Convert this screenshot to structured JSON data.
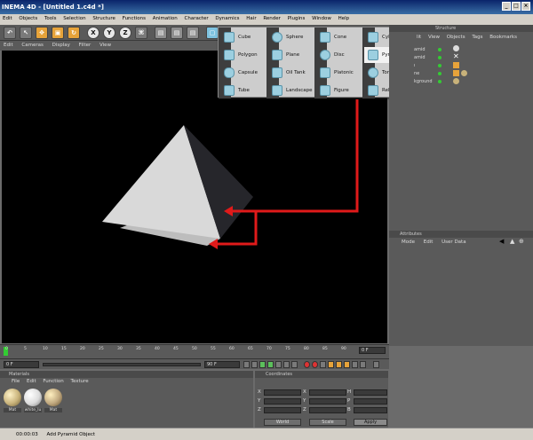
{
  "app": {
    "title": "INEMA 4D - [Untitled 1.c4d *]",
    "window_controls": [
      "_",
      "□",
      "×"
    ]
  },
  "menubar": [
    "Edit",
    "Objects",
    "Tools",
    "Selection",
    "Structure",
    "Functions",
    "Animation",
    "Character",
    "Dynamics",
    "Hair",
    "Render",
    "Plugins",
    "Window",
    "Help"
  ],
  "toolbar": {
    "axis_buttons": [
      "X",
      "Y",
      "Z"
    ]
  },
  "viewport": {
    "menu": [
      "Edit",
      "Cameras",
      "Display",
      "Filter",
      "View"
    ]
  },
  "dropdown": {
    "items": [
      {
        "label": "Cube",
        "icon": "cube-icon"
      },
      {
        "label": "Sphere",
        "icon": "sphere-icon"
      },
      {
        "label": "Cone",
        "icon": "cone-icon"
      },
      {
        "label": "Cylinder",
        "icon": "cylinder-icon"
      },
      {
        "label": "Polygon",
        "icon": "polygon-icon"
      },
      {
        "label": "Plane",
        "icon": "plane-icon"
      },
      {
        "label": "Disc",
        "icon": "disc-icon"
      },
      {
        "label": "Pyramid",
        "icon": "pyramid-icon",
        "selected": true
      },
      {
        "label": "Capsule",
        "icon": "capsule-icon"
      },
      {
        "label": "Oil Tank",
        "icon": "oil-tank-icon"
      },
      {
        "label": "Platonic",
        "icon": "platonic-icon"
      },
      {
        "label": "Torus",
        "icon": "torus-icon"
      },
      {
        "label": "Tube",
        "icon": "tube-icon"
      },
      {
        "label": "Landscape",
        "icon": "landscape-icon"
      },
      {
        "label": "Figure",
        "icon": "figure-icon"
      },
      {
        "label": "Relief",
        "icon": "relief-icon"
      }
    ]
  },
  "objects_panel": {
    "header": "Structure",
    "menu": [
      "lit",
      "View",
      "Objects",
      "Tags",
      "Bookmarks"
    ],
    "rows": [
      "amid",
      "amid",
      "ı",
      "ne",
      "kground"
    ]
  },
  "attributes_panel": {
    "header": "Attributes",
    "menu": [
      "Mode",
      "Edit",
      "User Data"
    ]
  },
  "timeline": {
    "ticks": [
      "0",
      "5",
      "10",
      "15",
      "20",
      "25",
      "30",
      "35",
      "40",
      "45",
      "50",
      "55",
      "60",
      "65",
      "70",
      "75",
      "80",
      "85",
      "90"
    ],
    "end_field": "0 F",
    "start_field": "0 F",
    "end_frame": "90 F"
  },
  "materials_panel": {
    "header": "Materials",
    "menu": [
      "File",
      "Edit",
      "Function",
      "Texture"
    ],
    "materials": [
      {
        "label": "Mat",
        "color": "#c8b27a"
      },
      {
        "label": "white_lu",
        "color": "#e8e8e8"
      },
      {
        "label": "Mat",
        "color": "#bfa77e"
      }
    ]
  },
  "coordinates_panel": {
    "header": "Coordinates",
    "axes": [
      "X",
      "Y",
      "Z"
    ],
    "mode_world": "World",
    "mode_scale": "Scale",
    "apply": "Apply"
  },
  "statusbar": {
    "time": "00:00:03",
    "message": "Add Pyramid Object"
  },
  "colors": {
    "viewport_bg": "#000000",
    "arrow": "#e01a1a",
    "pyramid_light": "#d9d9d9",
    "pyramid_dark": "#26262b"
  }
}
